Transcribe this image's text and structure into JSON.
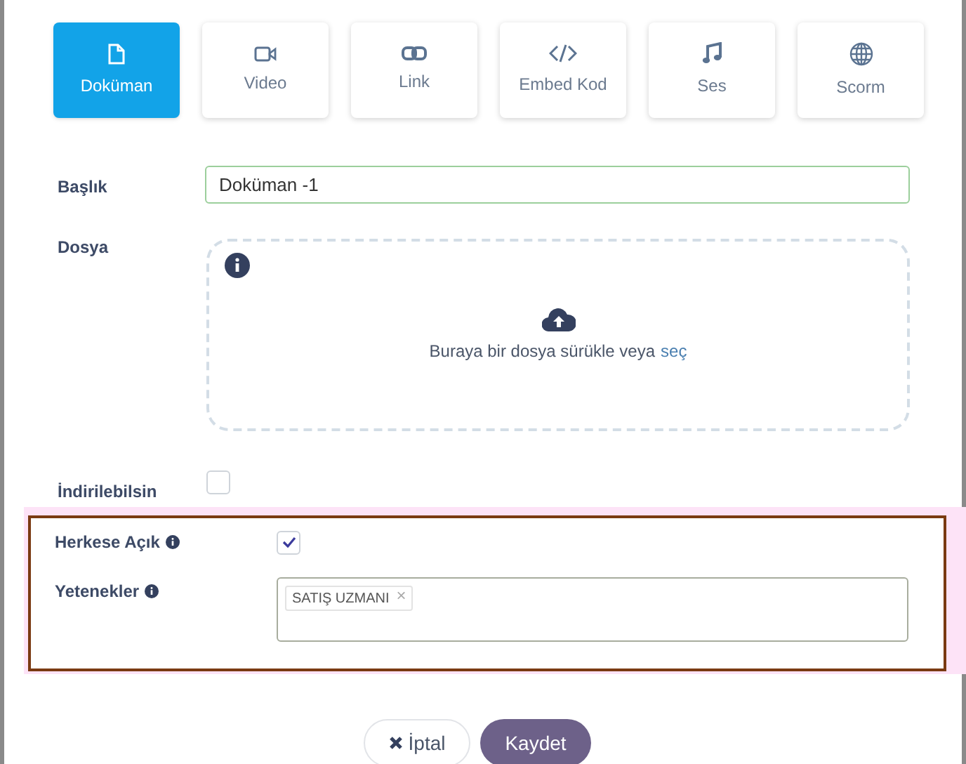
{
  "tabs": [
    {
      "label": "Doküman",
      "selected": true
    },
    {
      "label": "Video",
      "selected": false
    },
    {
      "label": "Link",
      "selected": false
    },
    {
      "label": "Embed Kod",
      "selected": false
    },
    {
      "label": "Ses",
      "selected": false
    },
    {
      "label": "Scorm",
      "selected": false
    }
  ],
  "title_field": {
    "label": "Başlık",
    "value": "Doküman -1"
  },
  "file_field": {
    "label": "Dosya",
    "drop_text": "Buraya bir dosya sürükle veya",
    "drop_link": "seç"
  },
  "downloadable": {
    "label": "İndirilebilsin",
    "checked": false
  },
  "public": {
    "label": "Herkese Açık",
    "checked": true
  },
  "skills": {
    "label": "Yetenekler",
    "tags": [
      {
        "label": "SATIŞ UZMANI",
        "remove": "×"
      }
    ]
  },
  "buttons": {
    "cancel": "İptal",
    "save": "Kaydet"
  }
}
